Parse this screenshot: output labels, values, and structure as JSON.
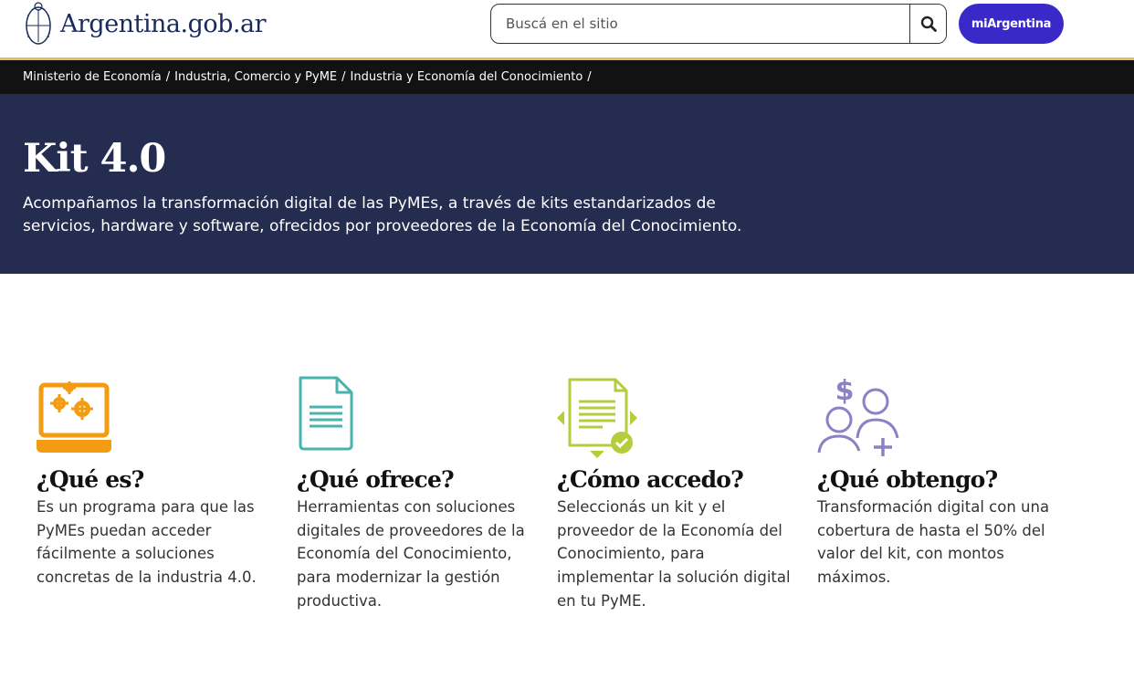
{
  "header": {
    "logo_text": "Argentina.gob.ar",
    "search_placeholder": "Buscá en el sitio",
    "mi_argentina_label": "miArgentina"
  },
  "breadcrumb": [
    {
      "label": "Ministerio de Economía"
    },
    {
      "label": "Industria, Comercio y PyME"
    },
    {
      "label": "Industria y Economía del Conocimiento"
    }
  ],
  "breadcrumb_separator": "/",
  "hero": {
    "title": "Kit 4.0",
    "description": "Acompañamos la transformación digital de las PyMEs, a través de kits estandarizados de servicios, hardware y software, ofrecidos por proveedores de la Economía del Conocimiento."
  },
  "features": [
    {
      "title": "¿Qué es?",
      "text": "Es un programa para que las PyMEs puedan acceder fácilmente a soluciones concretas de la industria 4.0.",
      "icon": "laptop-gears-icon",
      "color": "#f39c12"
    },
    {
      "title": "¿Qué ofrece?",
      "text": "Herramientas con soluciones digitales de proveedores de la Economía del Conocimiento, para modernizar la gestión productiva.",
      "icon": "document-icon",
      "color": "#4bb3ad"
    },
    {
      "title": "¿Cómo accedo?",
      "text": "Seleccionás un kit y el proveedor de la Economía del Conocimiento, para implementar la solución digital en tu PyME.",
      "icon": "document-check-icon",
      "color": "#b5cc3b"
    },
    {
      "title": "¿Qué obtengo?",
      "text": "Transformación digital con una cobertura de hasta el 50% del valor del kit, con montos máximos.",
      "icon": "people-money-icon",
      "color": "#8e80c4"
    }
  ],
  "colors": {
    "header_border": "#e7ba61",
    "breadcrumb_bg": "#121212",
    "hero_bg": "#242c4f",
    "mi_argentina_bg": "#3a29c9"
  }
}
